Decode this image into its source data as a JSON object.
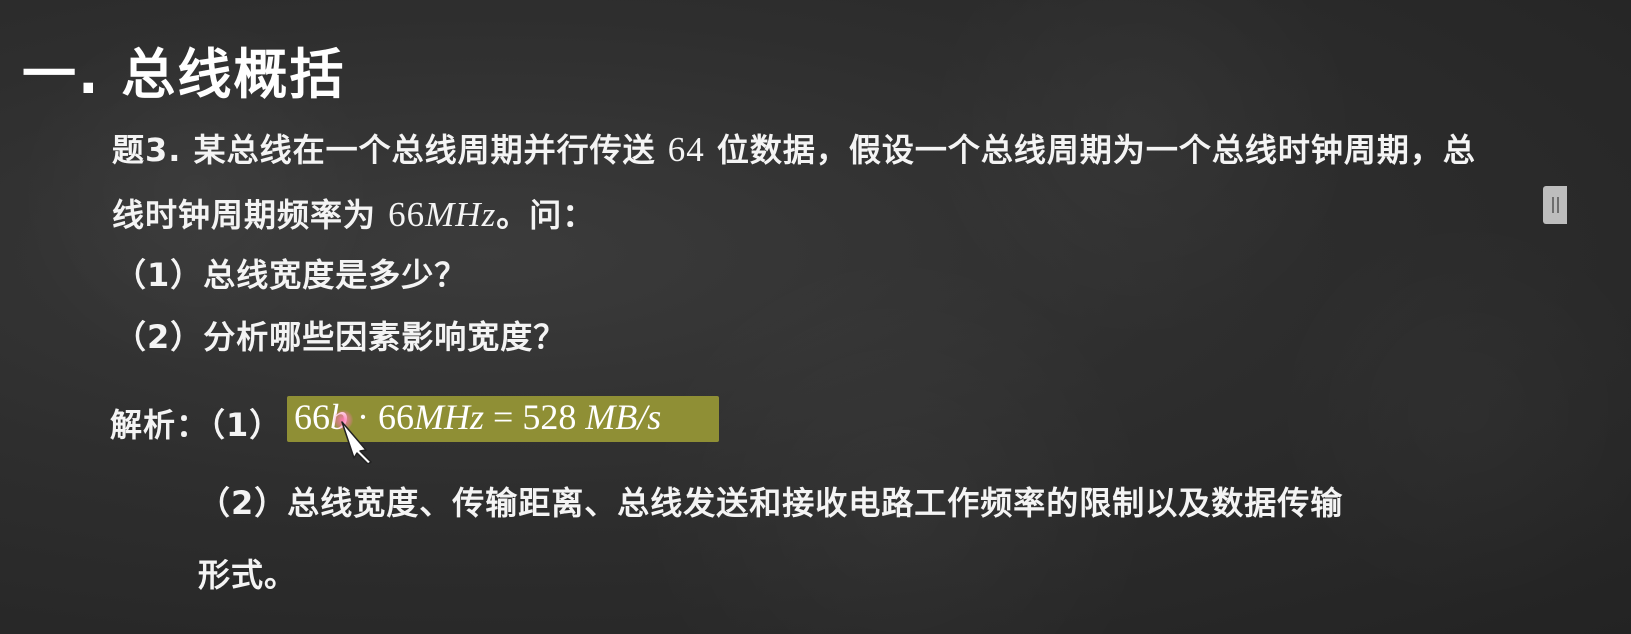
{
  "title": "一. 总线概括",
  "question": {
    "line1_prefix": "题3. 某总线在一个总线周期并行传送 ",
    "line1_num": "64",
    "line1_suffix": " 位数据，假设一个总线周期为一个总线时钟周期，总",
    "line2_prefix": "线时钟周期频率为 ",
    "line2_num": "66",
    "line2_unit": "MHz",
    "line2_suffix": "。问：",
    "sub1": "（1）总线宽度是多少？",
    "sub2": "（2）分析哪些因素影响宽度？"
  },
  "answer": {
    "label": "解析：（1）",
    "formula": {
      "a_num": "66",
      "a_unit": "b",
      "dot": " · ",
      "b_num": "66",
      "b_unit": "MHz",
      "eq": " = ",
      "result": "528",
      "result_unit": " MB/s"
    },
    "part2_line1": "（2）总线宽度、传输距离、总线发送和接收电路工作频率的限制以及数据传输",
    "part2_line2": "形式。"
  },
  "colors": {
    "background": "#2e2e2e",
    "highlight": "#8f8f35",
    "text": "#f4f4f4"
  },
  "icons": {
    "side_handle": "panel-handle-icon",
    "cursor": "pen-cursor-icon"
  }
}
